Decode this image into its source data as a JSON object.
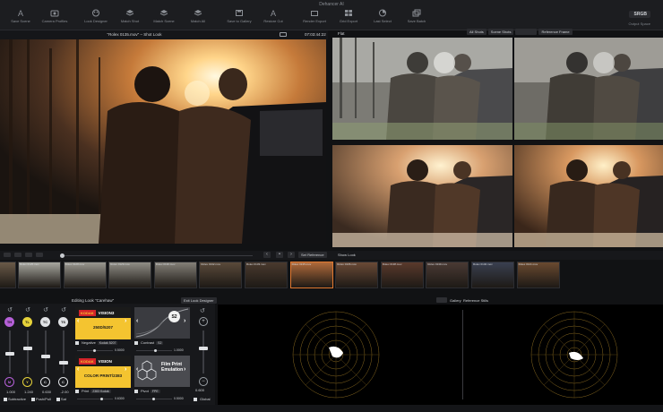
{
  "app": {
    "title": "Dehancer AI"
  },
  "toolbar": {
    "tools": [
      {
        "label": "Save Scene",
        "icon": "letter-a-icon"
      },
      {
        "label": "Camera Profiles",
        "icon": "camera-icon"
      },
      {
        "label": "Look Designer",
        "icon": "palette-icon"
      },
      {
        "label": "Match Shot",
        "icon": "layers-icon"
      },
      {
        "label": "Match Scene",
        "icon": "layers-icon"
      },
      {
        "label": "Match All",
        "icon": "layers-icon"
      },
      {
        "label": "Save to Gallery",
        "icon": "save-icon"
      },
      {
        "label": "Restore Cut",
        "icon": "letter-a-icon"
      },
      {
        "label": "Render Export",
        "icon": "film-icon"
      },
      {
        "label": "Grid Export",
        "icon": "grid-icon"
      },
      {
        "label": "Last Select",
        "icon": "circle-icon"
      },
      {
        "label": "Save Batch",
        "icon": "stack-icon"
      }
    ],
    "color_space": {
      "value": "SRGB",
      "label": "Output Space"
    }
  },
  "viewer": {
    "shot_title": "\"Rolex 0135.mov\" – Shot Look",
    "timecode": "07:03:44:22",
    "flat_label": "Flat",
    "grid_tabs": [
      "All Shots",
      "Scene Shots",
      "",
      "Reference Frame"
    ]
  },
  "timeline": {
    "set_reference": "Set Reference",
    "show_look": "Show Look",
    "nav_prev": "‹",
    "nav_next": "›",
    "clips": [
      {
        "name": "",
        "active": false
      },
      {
        "name": "Rolex 0125.mov",
        "active": false
      },
      {
        "name": "Rolex 0128.mov",
        "active": false
      },
      {
        "name": "Rolex 0129.mov",
        "active": false
      },
      {
        "name": "Rolex 0130.mov",
        "active": false
      },
      {
        "name": "Rolex 0132.mov",
        "active": false
      },
      {
        "name": "Rolex 0133.mov",
        "active": false
      },
      {
        "name": "Rolex 0135.mov",
        "active": true
      },
      {
        "name": "Rolex 0136.mov",
        "active": false
      },
      {
        "name": "Rolex 0138.mov",
        "active": false
      },
      {
        "name": "Rolex 0139.mov",
        "active": false
      },
      {
        "name": "Rolex 0140.mov",
        "active": false
      },
      {
        "name": "Rolex 0141.mov",
        "active": false
      }
    ]
  },
  "look_panel": {
    "title": "Editing Look \"Carehaw\"",
    "look_designer_button": "Exit Look Designer",
    "gallery_label": "Gallery",
    "reference_stills_label": "Reference Stills",
    "sliders": [
      {
        "top_badge": "TH",
        "bottom_badge": "M",
        "value": "1.000",
        "color": "#b560d8",
        "knob_pos": 0.55
      },
      {
        "top_badge": "TL",
        "bottom_badge": "Y",
        "value": "1.240",
        "color": "#e6d23a",
        "knob_pos": 0.42
      },
      {
        "top_badge": "TC",
        "bottom_badge": "C",
        "value": "0.630",
        "color": "#e0e2e5",
        "knob_pos": 0.6
      },
      {
        "top_badge": "TS",
        "bottom_badge": "C",
        "value": "-2.00",
        "color": "#e0e2e5",
        "knob_pos": 0.75
      }
    ],
    "checkboxes": [
      "Subtractive",
      "Push/Pull",
      "Sat"
    ],
    "negative": {
      "brand": "KODAK",
      "name": "VISION3",
      "sub": "250D/5207",
      "label": "Negative",
      "dropdown": "Kodak 5207",
      "value": "0.5000"
    },
    "print": {
      "brand": "KODAK",
      "name": "VISION",
      "sub": "COLOR PRINT/2383",
      "label": "Print",
      "dropdown": "2383 Kodak",
      "value": "0.6300"
    },
    "s2": {
      "badge": "S2",
      "label": "Contrast",
      "dropdown": "S2",
      "value": "1.0000"
    },
    "film_print": {
      "text": "Film Print Emulation",
      "label": "Pivot",
      "dropdown": "FPE",
      "value": "0.5000"
    },
    "right_slider": {
      "value": "0.600",
      "global_label": "Global"
    }
  }
}
